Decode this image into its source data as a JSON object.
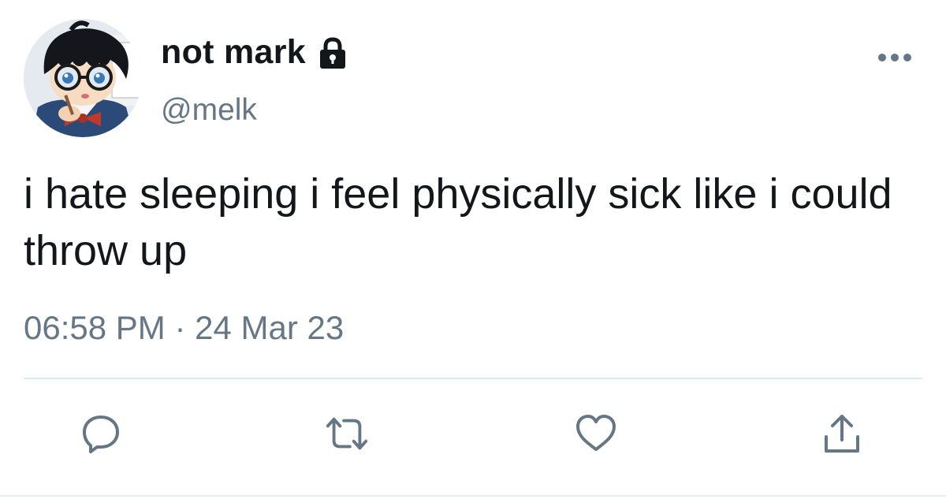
{
  "tweet": {
    "author": {
      "display_name": "not mark",
      "handle": "@melk",
      "avatar_icon": "anime-character-avatar",
      "protected_icon": "lock-icon"
    },
    "text": "i hate sleeping i feel physically sick like i could throw up",
    "timestamp": "06:58 PM · 24 Mar 23",
    "menu_icon": "more-options-icon",
    "actions": [
      {
        "name": "reply",
        "icon": "reply-icon"
      },
      {
        "name": "retweet",
        "icon": "retweet-icon"
      },
      {
        "name": "like",
        "icon": "heart-icon"
      },
      {
        "name": "share",
        "icon": "share-icon"
      }
    ]
  },
  "colors": {
    "text_primary": "#14171a",
    "text_secondary": "#657786",
    "action_icon": "#657786",
    "divider": "#e1e8ed"
  }
}
